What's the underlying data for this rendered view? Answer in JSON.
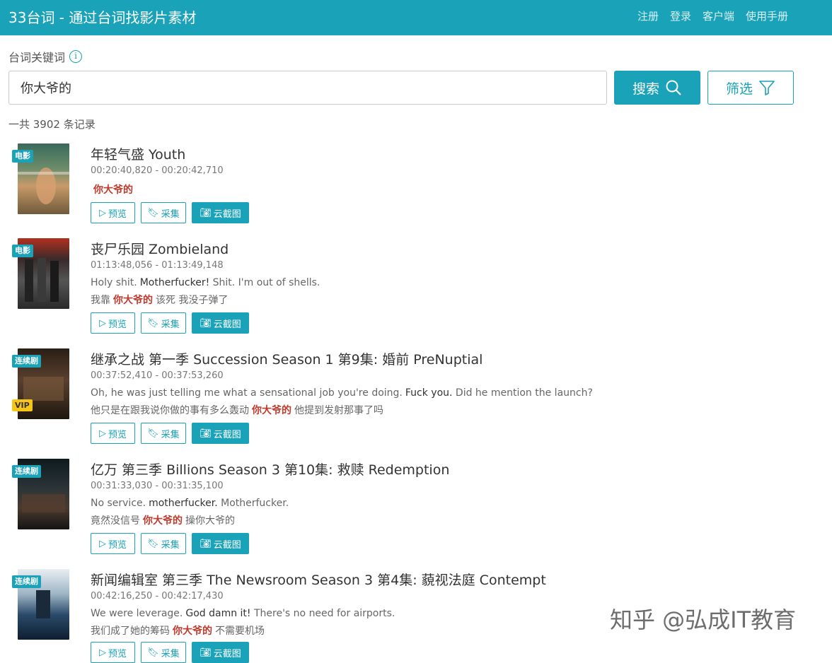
{
  "header": {
    "brand": "33台词 - 通过台词找影片素材",
    "nav": [
      "注册",
      "登录",
      "客户端",
      "使用手册"
    ]
  },
  "search": {
    "label": "台词关键词",
    "value": "你大爷的",
    "search_button": "搜索",
    "filter_button": "筛选"
  },
  "count_text": "一共 3902 条记录",
  "actions": {
    "preview": "预览",
    "collect": "采集",
    "screenshot": "云截图"
  },
  "results": [
    {
      "type": "电影",
      "vip": false,
      "title": "年轻气盛 Youth",
      "time": "00:20:40,820 - 00:20:42,710",
      "en_pre": "",
      "en_hl": "",
      "en_post": "",
      "zh_pre": "",
      "zh_hl": "你大爷的",
      "zh_post": ""
    },
    {
      "type": "电影",
      "vip": false,
      "title": "丧尸乐园 Zombieland",
      "time": "01:13:48,056 - 01:13:49,148",
      "en_pre": "Holy shit.",
      "en_hl": "Motherfucker!",
      "en_post": " Shit. I'm out of shells.",
      "zh_pre": "我靠",
      "zh_hl": "你大爷的",
      "zh_post": "该死 我没子弹了"
    },
    {
      "type": "连续剧",
      "vip": true,
      "vip_label": "VIP",
      "title": "继承之战 第一季 Succession Season 1 第9集: 婚前 PreNuptial",
      "time": "00:37:52,410 - 00:37:53,260",
      "en_pre": "Oh, he was just telling me what a sensational job you're doing.",
      "en_hl": "Fuck you.",
      "en_post": " Did he mention the launch?",
      "zh_pre": "他只是在跟我说你做的事有多么轰动",
      "zh_hl": "你大爷的",
      "zh_post": "他提到发射那事了吗"
    },
    {
      "type": "连续剧",
      "vip": false,
      "title": "亿万 第三季 Billions Season 3 第10集: 救赎 Redemption",
      "time": "00:31:33,030 - 00:31:35,100",
      "en_pre": "No service.",
      "en_hl": "motherfucker.",
      "en_post": " Motherfucker.",
      "zh_pre": "竟然没信号",
      "zh_hl": "你大爷的",
      "zh_post": "操你大爷的"
    },
    {
      "type": "连续剧",
      "vip": false,
      "title": "新闻编辑室 第三季 The Newsroom Season 3 第4集: 藐视法庭 Contempt",
      "time": "00:42:16,250 - 00:42:17,430",
      "en_pre": "We were leverage.",
      "en_hl": "God damn it!",
      "en_post": " There's no need for airports.",
      "zh_pre": "我们成了她的筹码",
      "zh_hl": "你大爷的",
      "zh_post": "不需要机场"
    }
  ],
  "watermark": "知乎 @弘成IT教育"
}
